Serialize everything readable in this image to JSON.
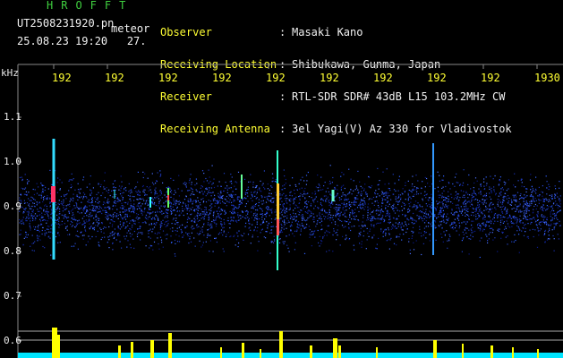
{
  "header": {
    "logo": "HROFFT",
    "filename": "UT2508231920.pn",
    "mode": "meteor",
    "datetime": "25.08.23 19:20   27.",
    "fields": [
      {
        "label": "Observer",
        "value": "Masaki Kano"
      },
      {
        "label": "Receiving Location",
        "value": "Shibukawa, Gunma, Japan"
      },
      {
        "label": "Receiver",
        "value": "RTL-SDR SDR# 43dB L15 103.2MHz CW"
      },
      {
        "label": "Receiving Antenna",
        "value": "3el Yagi(V) Az 330 for Vladivostok"
      }
    ],
    "separator": ":"
  },
  "axes": {
    "y_unit": "kHz",
    "y_ticks": [
      "1.1",
      "1.0",
      "0.9",
      "0.8",
      "0.7",
      "0.6"
    ],
    "x_ticks": [
      "192",
      "192",
      "192",
      "192",
      "192",
      "192",
      "192",
      "192",
      "192",
      "1930"
    ]
  },
  "colors": {
    "header_green": "#3fcf3f",
    "tick_yellow": "#ffff33",
    "echo_cyan": "#00e5ff",
    "echo_yellow": "#ffff00"
  }
}
